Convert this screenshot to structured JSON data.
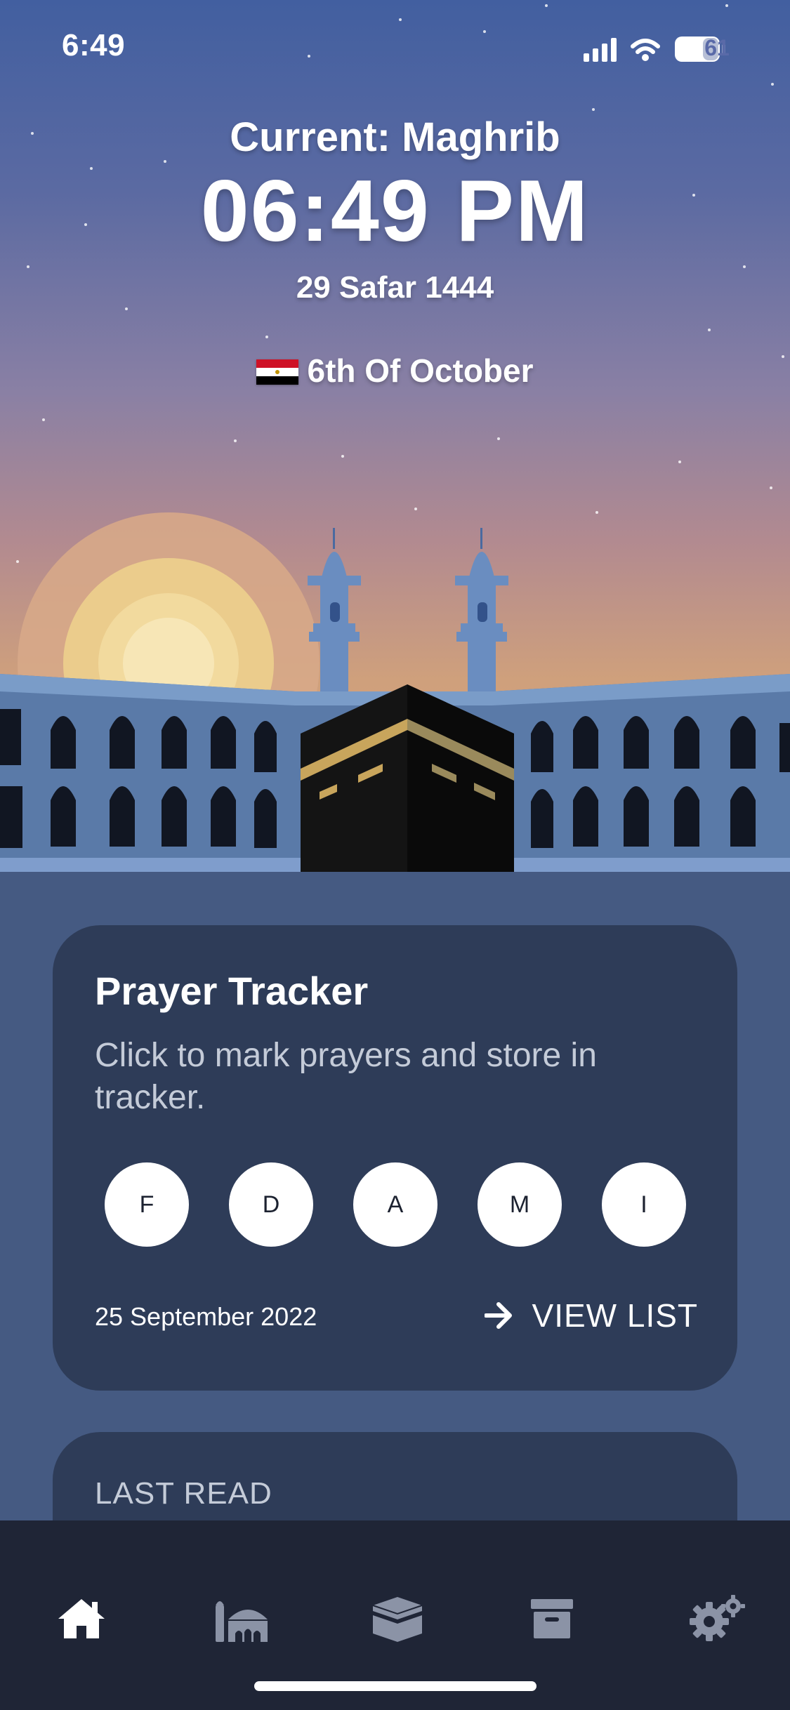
{
  "status_bar": {
    "time": "6:49",
    "battery": "61"
  },
  "header": {
    "current_prayer": "Current: Maghrib",
    "current_time": "06:49 PM",
    "hijri_date": "29 Safar 1444",
    "location": "6th Of October",
    "flag_icon": "egypt-flag-icon"
  },
  "tracker": {
    "title": "Prayer Tracker",
    "subtitle": "Click to mark prayers and store in tracker.",
    "prayers": [
      "F",
      "D",
      "A",
      "M",
      "I"
    ],
    "date": "25 September 2022",
    "view_list_label": "VIEW LIST",
    "view_list_icon": "arrow-right-icon"
  },
  "last_read": {
    "label": "LAST READ"
  },
  "tabbar": {
    "tabs": [
      {
        "icon": "home-icon",
        "active": true
      },
      {
        "icon": "mosque-icon",
        "active": false
      },
      {
        "icon": "kaaba-icon",
        "active": false
      },
      {
        "icon": "archive-icon",
        "active": false
      },
      {
        "icon": "settings-gears-icon",
        "active": false
      }
    ]
  },
  "colors": {
    "sky_top": "#425fa0",
    "sky_bottom": "#d7a876",
    "card_bg": "#2e3c58",
    "page_bg": "#455a82",
    "tabbar_bg": "#1f2536",
    "inactive_icon": "#8b93a6"
  }
}
